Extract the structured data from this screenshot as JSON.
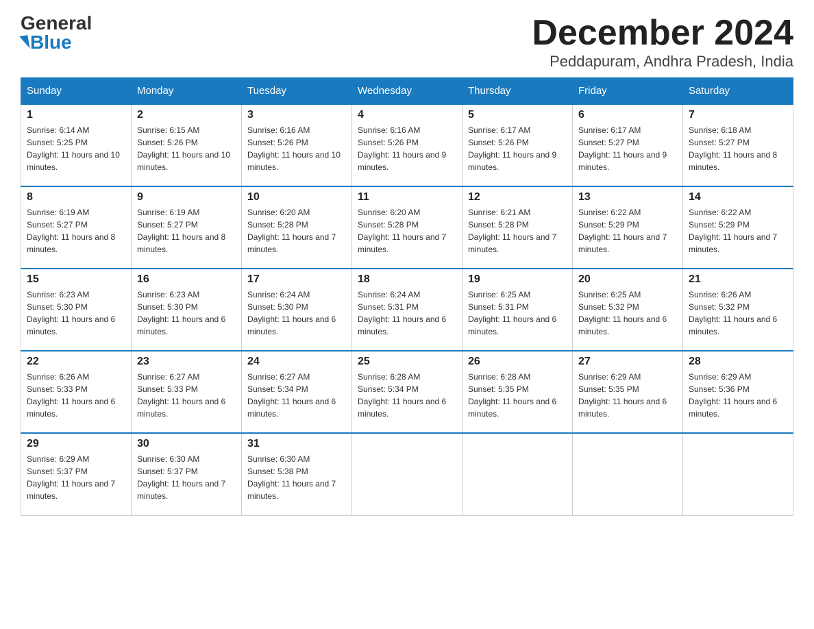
{
  "logo": {
    "general": "General",
    "blue": "Blue"
  },
  "title": "December 2024",
  "subtitle": "Peddapuram, Andhra Pradesh, India",
  "headers": [
    "Sunday",
    "Monday",
    "Tuesday",
    "Wednesday",
    "Thursday",
    "Friday",
    "Saturday"
  ],
  "weeks": [
    [
      {
        "day": "1",
        "sunrise": "6:14 AM",
        "sunset": "5:25 PM",
        "daylight": "11 hours and 10 minutes."
      },
      {
        "day": "2",
        "sunrise": "6:15 AM",
        "sunset": "5:26 PM",
        "daylight": "11 hours and 10 minutes."
      },
      {
        "day": "3",
        "sunrise": "6:16 AM",
        "sunset": "5:26 PM",
        "daylight": "11 hours and 10 minutes."
      },
      {
        "day": "4",
        "sunrise": "6:16 AM",
        "sunset": "5:26 PM",
        "daylight": "11 hours and 9 minutes."
      },
      {
        "day": "5",
        "sunrise": "6:17 AM",
        "sunset": "5:26 PM",
        "daylight": "11 hours and 9 minutes."
      },
      {
        "day": "6",
        "sunrise": "6:17 AM",
        "sunset": "5:27 PM",
        "daylight": "11 hours and 9 minutes."
      },
      {
        "day": "7",
        "sunrise": "6:18 AM",
        "sunset": "5:27 PM",
        "daylight": "11 hours and 8 minutes."
      }
    ],
    [
      {
        "day": "8",
        "sunrise": "6:19 AM",
        "sunset": "5:27 PM",
        "daylight": "11 hours and 8 minutes."
      },
      {
        "day": "9",
        "sunrise": "6:19 AM",
        "sunset": "5:27 PM",
        "daylight": "11 hours and 8 minutes."
      },
      {
        "day": "10",
        "sunrise": "6:20 AM",
        "sunset": "5:28 PM",
        "daylight": "11 hours and 7 minutes."
      },
      {
        "day": "11",
        "sunrise": "6:20 AM",
        "sunset": "5:28 PM",
        "daylight": "11 hours and 7 minutes."
      },
      {
        "day": "12",
        "sunrise": "6:21 AM",
        "sunset": "5:28 PM",
        "daylight": "11 hours and 7 minutes."
      },
      {
        "day": "13",
        "sunrise": "6:22 AM",
        "sunset": "5:29 PM",
        "daylight": "11 hours and 7 minutes."
      },
      {
        "day": "14",
        "sunrise": "6:22 AM",
        "sunset": "5:29 PM",
        "daylight": "11 hours and 7 minutes."
      }
    ],
    [
      {
        "day": "15",
        "sunrise": "6:23 AM",
        "sunset": "5:30 PM",
        "daylight": "11 hours and 6 minutes."
      },
      {
        "day": "16",
        "sunrise": "6:23 AM",
        "sunset": "5:30 PM",
        "daylight": "11 hours and 6 minutes."
      },
      {
        "day": "17",
        "sunrise": "6:24 AM",
        "sunset": "5:30 PM",
        "daylight": "11 hours and 6 minutes."
      },
      {
        "day": "18",
        "sunrise": "6:24 AM",
        "sunset": "5:31 PM",
        "daylight": "11 hours and 6 minutes."
      },
      {
        "day": "19",
        "sunrise": "6:25 AM",
        "sunset": "5:31 PM",
        "daylight": "11 hours and 6 minutes."
      },
      {
        "day": "20",
        "sunrise": "6:25 AM",
        "sunset": "5:32 PM",
        "daylight": "11 hours and 6 minutes."
      },
      {
        "day": "21",
        "sunrise": "6:26 AM",
        "sunset": "5:32 PM",
        "daylight": "11 hours and 6 minutes."
      }
    ],
    [
      {
        "day": "22",
        "sunrise": "6:26 AM",
        "sunset": "5:33 PM",
        "daylight": "11 hours and 6 minutes."
      },
      {
        "day": "23",
        "sunrise": "6:27 AM",
        "sunset": "5:33 PM",
        "daylight": "11 hours and 6 minutes."
      },
      {
        "day": "24",
        "sunrise": "6:27 AM",
        "sunset": "5:34 PM",
        "daylight": "11 hours and 6 minutes."
      },
      {
        "day": "25",
        "sunrise": "6:28 AM",
        "sunset": "5:34 PM",
        "daylight": "11 hours and 6 minutes."
      },
      {
        "day": "26",
        "sunrise": "6:28 AM",
        "sunset": "5:35 PM",
        "daylight": "11 hours and 6 minutes."
      },
      {
        "day": "27",
        "sunrise": "6:29 AM",
        "sunset": "5:35 PM",
        "daylight": "11 hours and 6 minutes."
      },
      {
        "day": "28",
        "sunrise": "6:29 AM",
        "sunset": "5:36 PM",
        "daylight": "11 hours and 6 minutes."
      }
    ],
    [
      {
        "day": "29",
        "sunrise": "6:29 AM",
        "sunset": "5:37 PM",
        "daylight": "11 hours and 7 minutes."
      },
      {
        "day": "30",
        "sunrise": "6:30 AM",
        "sunset": "5:37 PM",
        "daylight": "11 hours and 7 minutes."
      },
      {
        "day": "31",
        "sunrise": "6:30 AM",
        "sunset": "5:38 PM",
        "daylight": "11 hours and 7 minutes."
      },
      null,
      null,
      null,
      null
    ]
  ]
}
